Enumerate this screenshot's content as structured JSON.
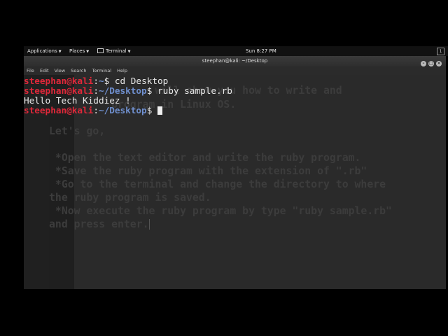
{
  "panel": {
    "applications_label": "Applications",
    "places_label": "Places",
    "terminal_label": "Terminal",
    "clock": "Sun  8:27 PM",
    "workspace": "1"
  },
  "window": {
    "title": "steephan@kali: ~/Desktop",
    "menu": [
      "File",
      "Edit",
      "View",
      "Search",
      "Terminal",
      "Help"
    ]
  },
  "terminal": {
    "lines": [
      {
        "user": "steephan@kali",
        "sep": ":",
        "path": "~",
        "cmd": "$ cd Desktop"
      },
      {
        "user": "steephan@kali",
        "sep": ":",
        "path": "~/Desktop",
        "cmd": "$ ruby sample.rb"
      },
      {
        "output": "Hello Tech Kiddiez !"
      },
      {
        "user": "steephan@kali",
        "sep": ":",
        "path": "~/Desktop",
        "cmd": "$ "
      }
    ]
  },
  "background_document": {
    "lines": [
      "                 will show you how to write and",
      "          program in Linux OS.",
      "",
      "Let's go,",
      "",
      " *Open the text editor and write the ruby program.",
      " *Save the ruby program with the extension of \".rb\"",
      " *Go to the terminal and change the directory to where",
      "the ruby program is saved.",
      " *Now execute the ruby program by type \"ruby sample.rb\"",
      "and press enter."
    ]
  },
  "colors": {
    "prompt_user": "#e0283a",
    "prompt_path": "#6f8fce",
    "terminal_bg": "#202020",
    "panel_bg": "#111111"
  }
}
